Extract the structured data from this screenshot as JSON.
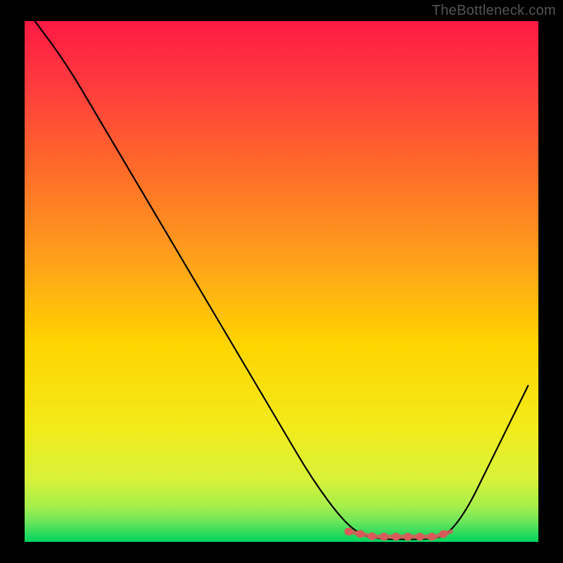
{
  "watermark": "TheBottleneck.com",
  "chart_data": {
    "type": "line",
    "title": "",
    "xlabel": "",
    "ylabel": "",
    "xlim": [
      0,
      100
    ],
    "ylim": [
      0,
      100
    ],
    "background_gradient": {
      "top": "#ff1a44",
      "mid": "#ffd400",
      "bottom": "#00d35f"
    },
    "series": [
      {
        "name": "bottleneck-curve",
        "stroke": "#000000",
        "points": [
          {
            "x": 2,
            "y": 100
          },
          {
            "x": 8,
            "y": 92
          },
          {
            "x": 14,
            "y": 82
          },
          {
            "x": 20,
            "y": 72
          },
          {
            "x": 26,
            "y": 62
          },
          {
            "x": 32,
            "y": 52
          },
          {
            "x": 38,
            "y": 42
          },
          {
            "x": 44,
            "y": 32
          },
          {
            "x": 50,
            "y": 22
          },
          {
            "x": 56,
            "y": 12
          },
          {
            "x": 62,
            "y": 4
          },
          {
            "x": 66,
            "y": 1
          },
          {
            "x": 70,
            "y": 0.5
          },
          {
            "x": 74,
            "y": 0.5
          },
          {
            "x": 78,
            "y": 0.5
          },
          {
            "x": 82,
            "y": 1
          },
          {
            "x": 86,
            "y": 6
          },
          {
            "x": 90,
            "y": 14
          },
          {
            "x": 94,
            "y": 22
          },
          {
            "x": 98,
            "y": 30
          }
        ]
      },
      {
        "name": "optimal-zone-marker",
        "stroke": "#d85a5a",
        "thickness": 10,
        "points": [
          {
            "x": 63,
            "y": 2
          },
          {
            "x": 68,
            "y": 1
          },
          {
            "x": 72,
            "y": 1
          },
          {
            "x": 76,
            "y": 1
          },
          {
            "x": 80,
            "y": 1
          },
          {
            "x": 83,
            "y": 2
          }
        ]
      }
    ]
  }
}
